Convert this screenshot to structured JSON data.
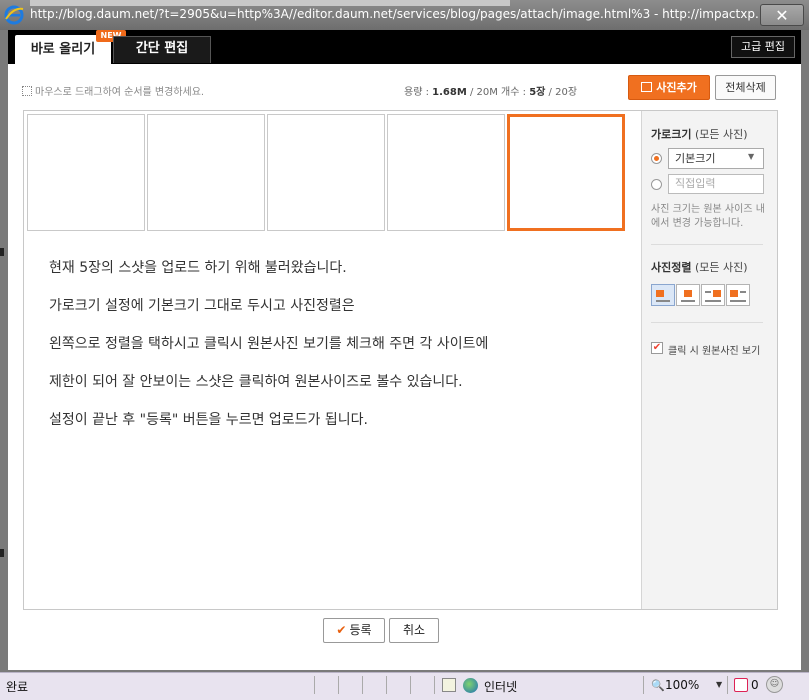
{
  "window": {
    "url": "http://blog.daum.net/?t=2905&u=http%3A//editor.daum.net/services/blog/pages/attach/image.html%3 - http://impactxp....",
    "close_symbol": "✕"
  },
  "tabs": {
    "quick_upload": "바로 올리기",
    "new_badge": "NEW",
    "simple_edit": "간단 편집"
  },
  "toolbar": {
    "advanced_edit": "고급 편집",
    "hint": "마우스로 드래그하여 순서를 변경하세요.",
    "capacity_label": "용량 :",
    "capacity_used": "1.68M",
    "capacity_total": "/ 20M",
    "count_label": "개수 :",
    "count_current": "5장",
    "count_total": "/ 20장",
    "add_photo": "사진추가",
    "delete_all": "전체삭제"
  },
  "thumbnails": [
    {
      "selected": false
    },
    {
      "selected": false
    },
    {
      "selected": false
    },
    {
      "selected": false
    },
    {
      "selected": true
    }
  ],
  "body_lines": [
    "현재 5장의 스샷을 업로드 하기 위해 불러왔습니다.",
    "가로크기 설정에 기본크기 그대로 두시고 사진정렬은",
    "왼쪽으로 정렬을 택하시고 클릭시 원본사진 보기를 체크해 주면 각 사이트에",
    "제한이 되어 잘 안보이는 스샷은 클릭하여 원본사이즈로 볼수 있습니다.",
    "설정이 끝난 후 \"등록\" 버튼을 누르면 업로드가 됩니다."
  ],
  "sidebar": {
    "size_title": "가로크기",
    "size_scope": "(모든 사진)",
    "default_size": "기본크기",
    "custom_placeholder": "직접입력",
    "size_note": "사진 크기는 원본 사이즈 내에서 변경 가능합니다.",
    "align_title": "사진정렬",
    "align_scope": "(모든 사진)",
    "align_selected": "left",
    "click_original_label": "클릭 시 원본사진 보기",
    "click_original_checked": true
  },
  "footer": {
    "register": "등록",
    "cancel": "취소"
  },
  "statusbar": {
    "status": "완료",
    "zone": "인터넷",
    "zoom": "100%",
    "badge_count": "0"
  },
  "colors": {
    "accent": "#f07020",
    "header": "#000000",
    "statusbar": "#e8e3ef"
  }
}
